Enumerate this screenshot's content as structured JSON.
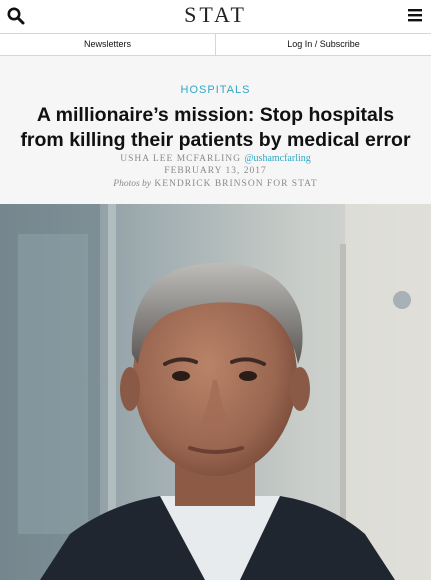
{
  "header": {
    "logo": "STAT",
    "search_icon": "search-icon",
    "menu_icon": "menu-icon"
  },
  "subnav": {
    "newsletters": "Newsletters",
    "login": "Log In / Subscribe"
  },
  "article": {
    "section": "HOSPITALS",
    "headline": "A millionaire’s mission: Stop hospitals from killing their patients by medical error",
    "author": "USHA LEE MCFARLING",
    "author_handle": "@ushamcfarling",
    "date": "FEBRUARY 13, 2017",
    "photo_prefix": "Photos by",
    "photo_credit": "KENDRICK BRINSON FOR STAT"
  },
  "colors": {
    "accent": "#2fa8c5",
    "header_bg": "#f6f6f6"
  }
}
